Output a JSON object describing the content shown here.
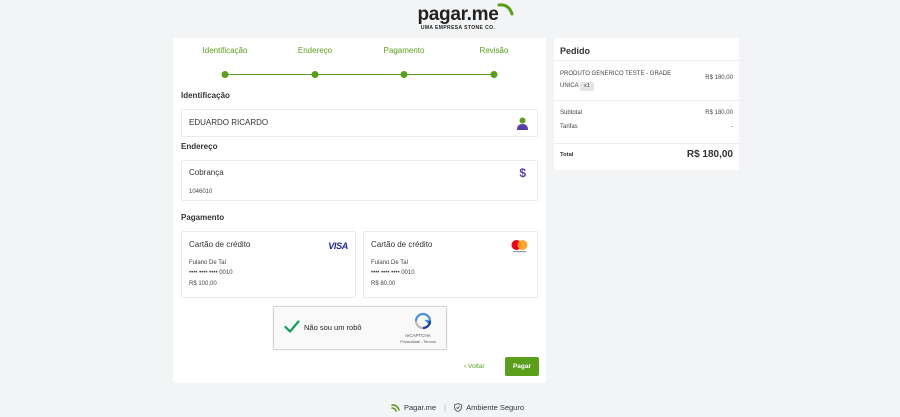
{
  "logo": {
    "name": "pagar",
    "dot": ".",
    "suffix": "me",
    "subtitle": "UMA EMPRESA STONE CO."
  },
  "steps": [
    {
      "label": "Identificação"
    },
    {
      "label": "Endereço"
    },
    {
      "label": "Pagamento"
    },
    {
      "label": "Revisão"
    }
  ],
  "identification": {
    "title": "Identificação",
    "name": "EDUARDO RICARDO",
    "icon": "user-icon"
  },
  "address": {
    "title": "Endereço",
    "label": "Cobrança",
    "zip": "1046010",
    "icon": "dollar-icon"
  },
  "payment": {
    "title": "Pagamento",
    "cards": [
      {
        "type": "Cartão de crédito",
        "brand": "VISA",
        "holder": "Fulano De Tal",
        "number": "•••• •••• •••• 0010",
        "amount": "R$ 100,00"
      },
      {
        "type": "Cartão de crédito",
        "brand": "mastercard",
        "holder": "Fulano De Tal",
        "number": "•••• •••• •••• 0010",
        "amount": "R$ 80,00"
      }
    ]
  },
  "captcha": {
    "label": "Não sou um robô",
    "brand": "reCAPTCHA",
    "links": "Privacidade - Termos"
  },
  "actions": {
    "back": "‹ Voltar",
    "pay": "Pagar"
  },
  "order": {
    "title": "Pedido",
    "product": "PRODUTO GENERICO TESTE - GRADE UNICA",
    "qty": "x1",
    "product_price": "R$ 180,00",
    "subtotal_label": "Subtotal",
    "subtotal": "R$ 180,00",
    "fees_label": "Tarifas",
    "fees": "-",
    "total_label": "Total",
    "total": "R$ 180,00"
  },
  "footer": {
    "brand": "Pagar.me",
    "separator": "|",
    "secure": "Ambiente Seguro"
  },
  "colors": {
    "accent": "#5a9e1b",
    "user_icon": "#5a9e1b",
    "dollar_icon": "#5b3fa8"
  }
}
